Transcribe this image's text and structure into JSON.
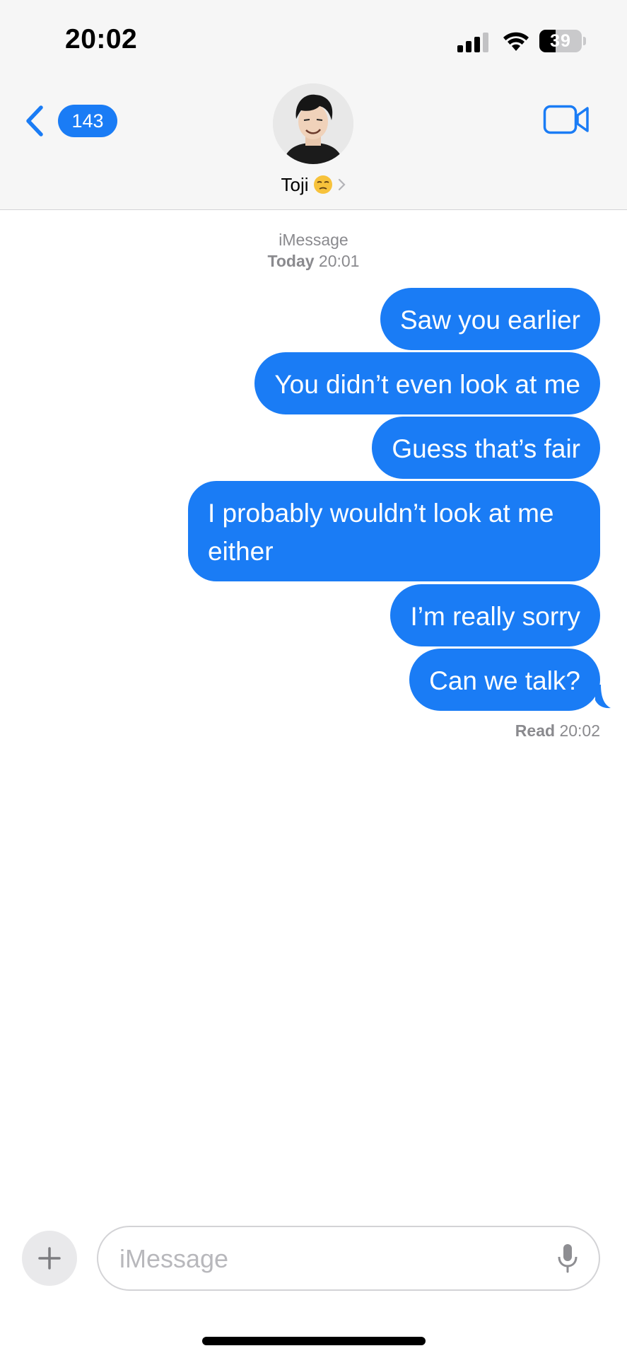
{
  "status_bar": {
    "time": "20:02",
    "battery_level": "39"
  },
  "header": {
    "back_badge_count": "143",
    "contact_name": "Toji",
    "contact_emoji_icon": "unamused-face-emoji",
    "video_icon": "video-camera-icon"
  },
  "thread": {
    "service_label": "iMessage",
    "day_label": "Today",
    "start_time": "20:01",
    "messages": [
      "Saw you earlier",
      "You didn’t even look at me",
      "Guess that’s fair",
      "I probably wouldn’t look at me either",
      "I’m really sorry",
      "Can we talk?"
    ],
    "read_label": "Read",
    "read_time": "20:02"
  },
  "compose": {
    "placeholder": "iMessage",
    "plus_icon": "plus-icon",
    "mic_icon": "microphone-icon"
  },
  "colors": {
    "accent": "#1a7cf5",
    "header_bg": "#f6f6f6",
    "meta_text": "#8a8a8e"
  }
}
